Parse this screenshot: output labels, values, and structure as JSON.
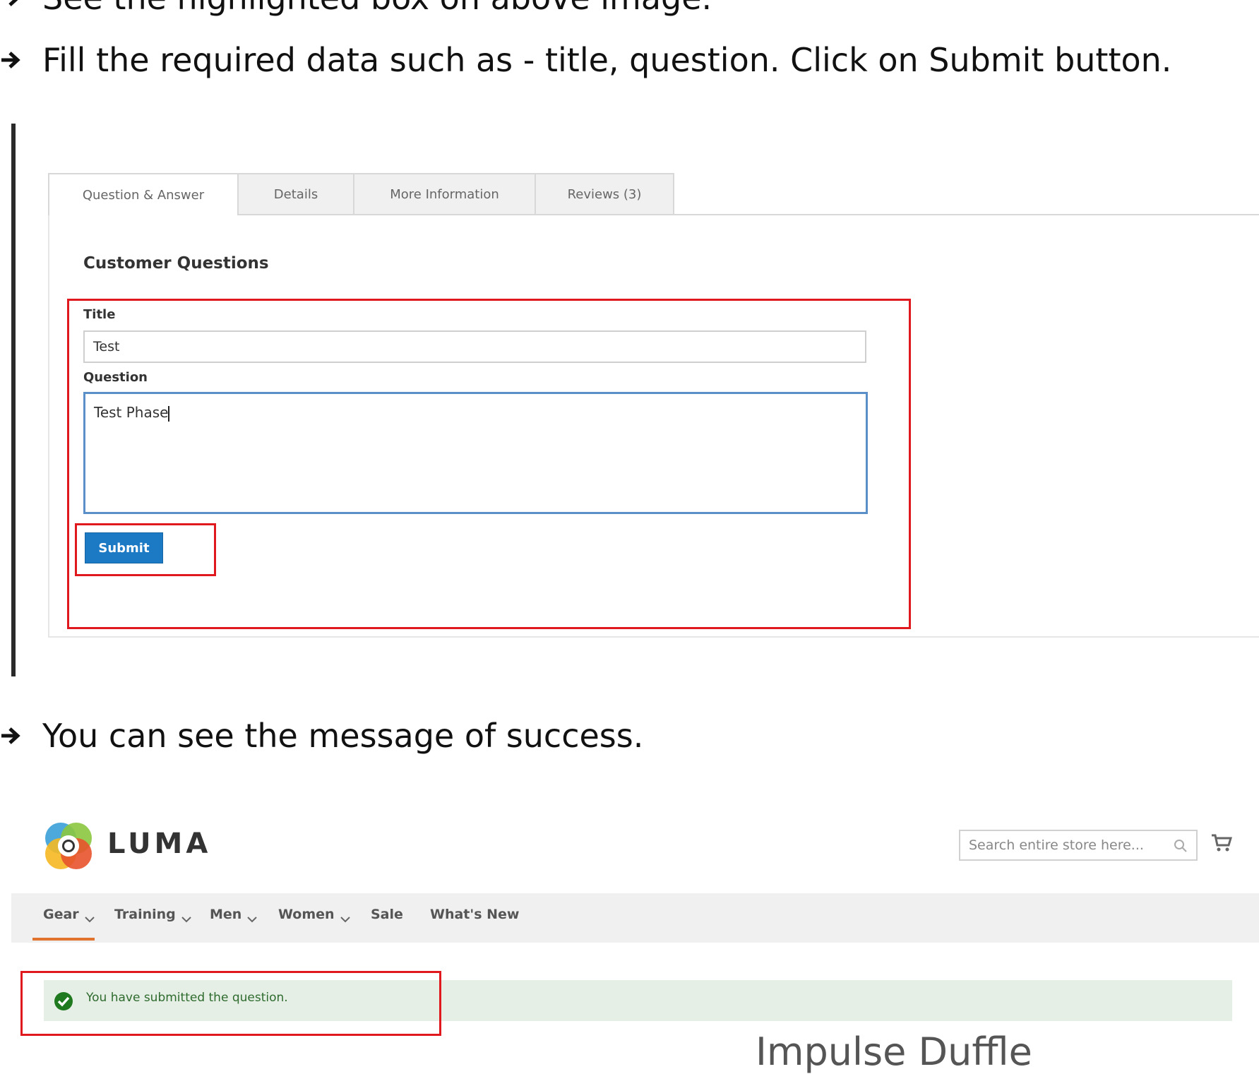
{
  "steps": {
    "step0": "See the highlighted box on above image.",
    "step1": "Fill the required data such as - title, question. Click on Submit button.",
    "step2": "You can see the message of success."
  },
  "form": {
    "tabs": [
      "Question & Answer",
      "Details",
      "More Information",
      "Reviews (3)"
    ],
    "section_title": "Customer Questions",
    "title_label": "Title",
    "title_value": "Test",
    "question_label": "Question",
    "question_value": "Test Phase",
    "submit_label": "Submit"
  },
  "store": {
    "logo_text": "LUMA",
    "search_placeholder": "Search entire store here...",
    "nav": [
      "Gear",
      "Training",
      "Men",
      "Women",
      "Sale",
      "What's New"
    ],
    "success_message": "You have submitted the question.",
    "product_title": "Impulse Duffle"
  },
  "colors": {
    "highlight": "#e0191f",
    "submit": "#1c79c4",
    "success_bg": "#e5efe5",
    "success_icon": "#1f7a1f",
    "nav_active": "#e0742f"
  }
}
